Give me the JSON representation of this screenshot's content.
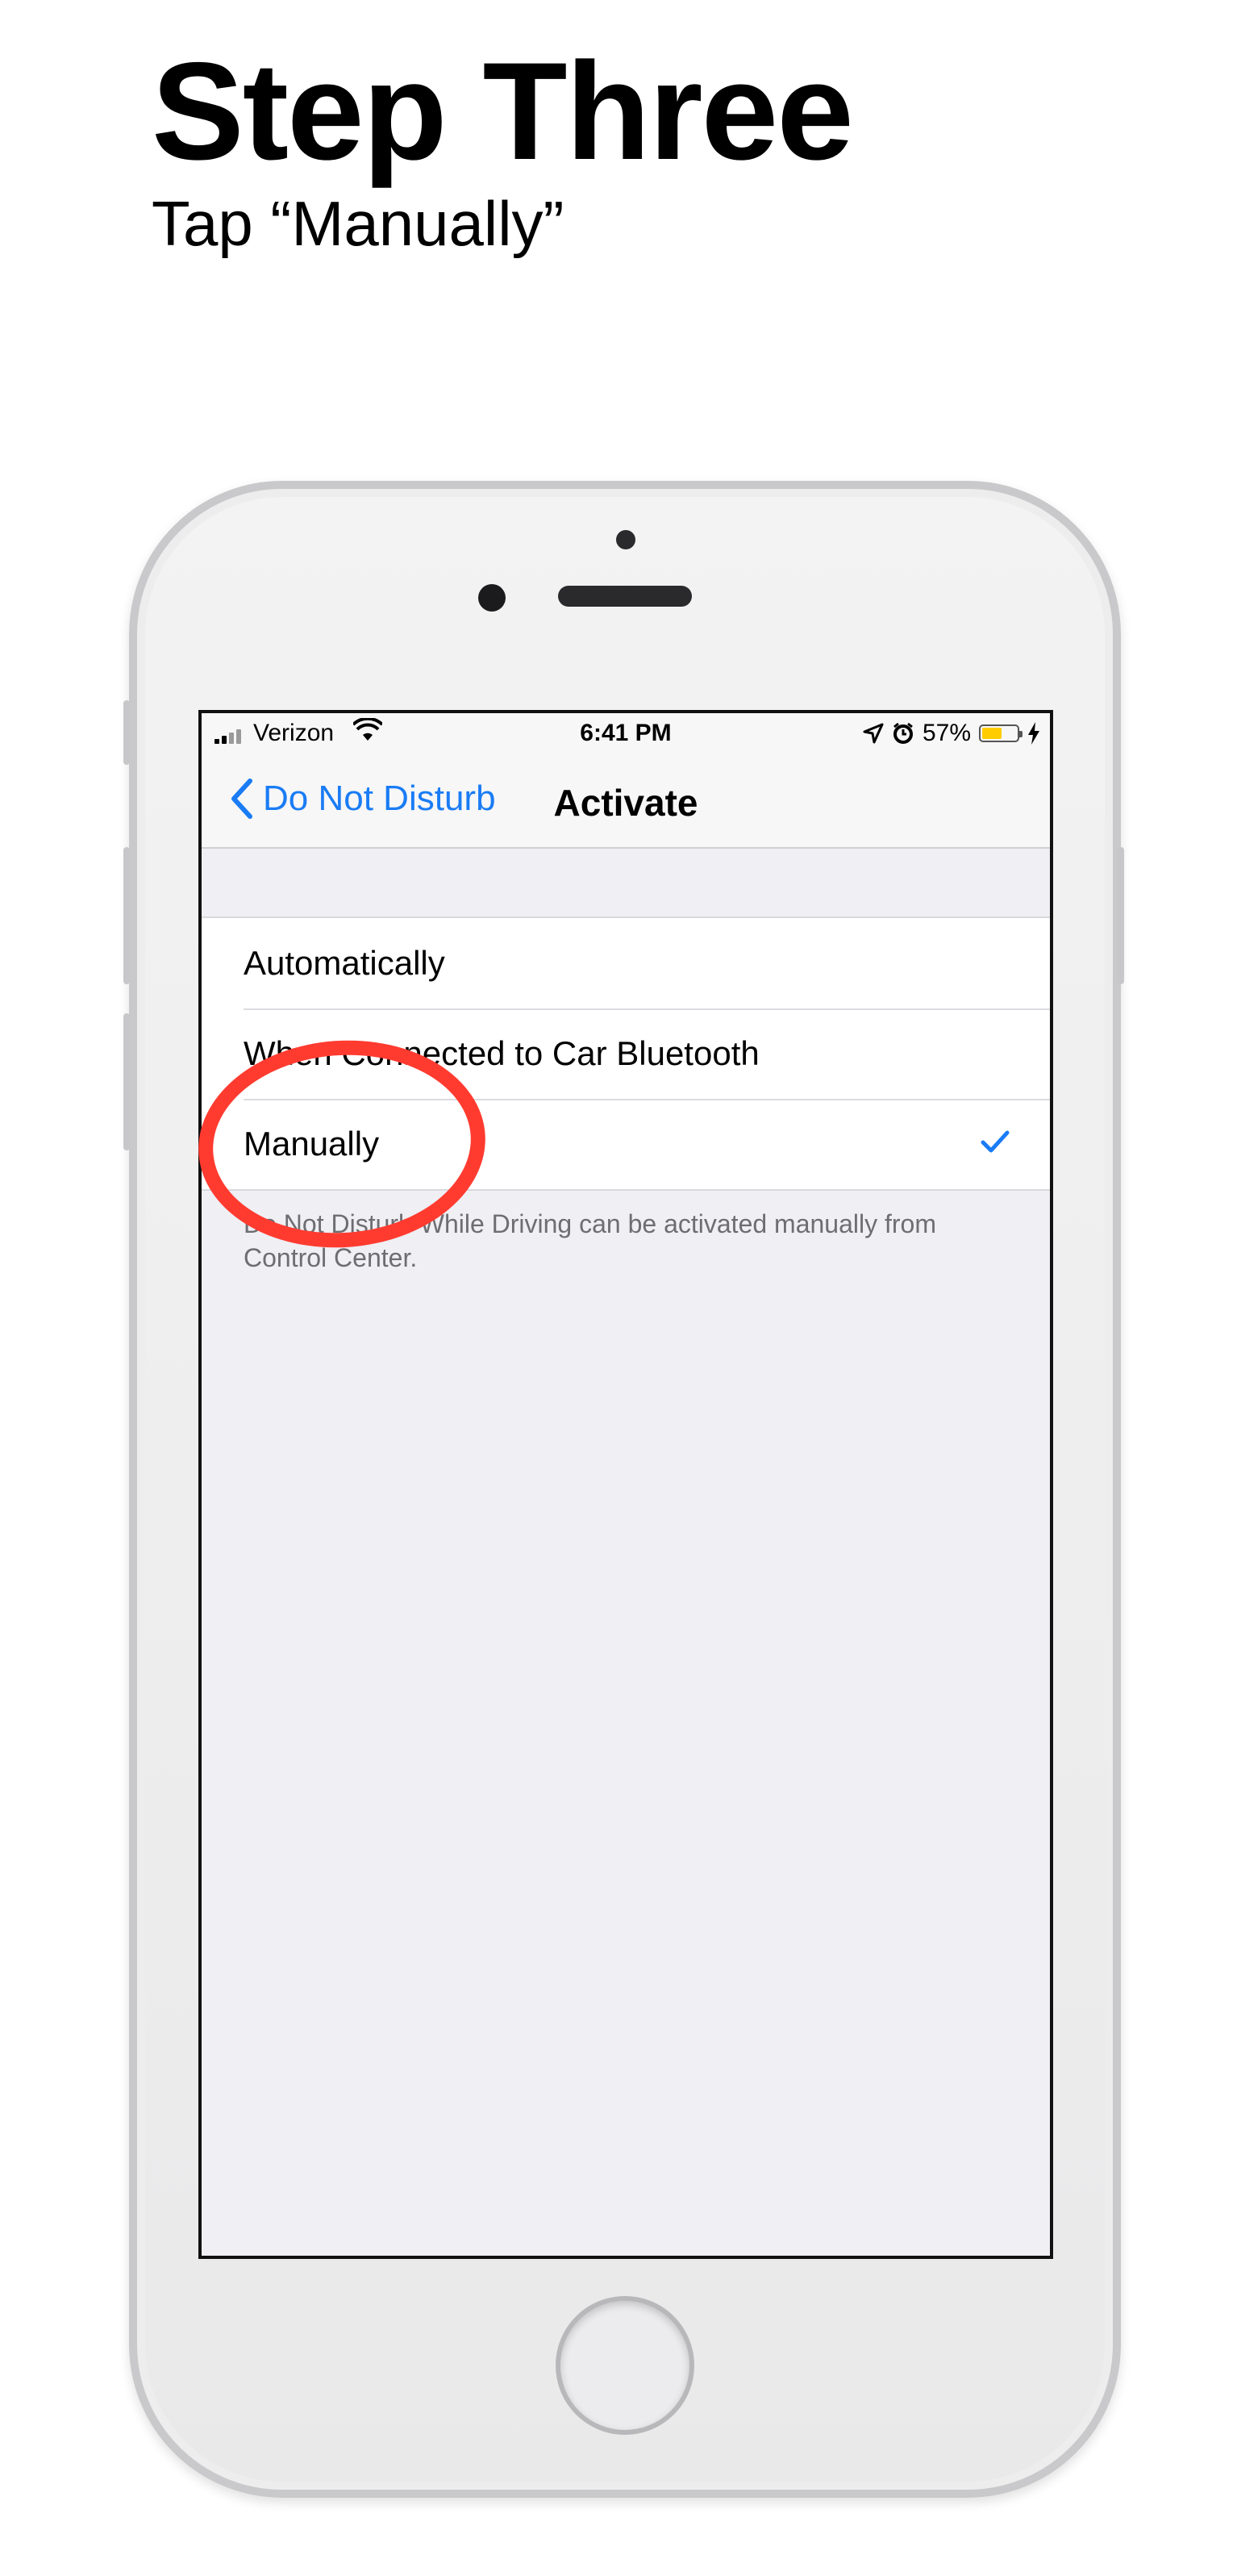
{
  "header": {
    "title": "Step Three",
    "subtitle": "Tap “Manually”"
  },
  "statusbar": {
    "carrier": "Verizon",
    "time": "6:41 PM",
    "battery_text": "57%",
    "battery_level": 0.57,
    "icons": [
      "signal-icon",
      "wifi-icon",
      "location-icon",
      "alarm-icon",
      "battery-icon",
      "charging-icon"
    ]
  },
  "navbar": {
    "back_label": "Do Not Disturb",
    "title": "Activate"
  },
  "options": [
    {
      "label": "Automatically",
      "selected": false
    },
    {
      "label": "When Connected to Car Bluetooth",
      "selected": false
    },
    {
      "label": "Manually",
      "selected": true
    }
  ],
  "footer_note": "Do Not Disturb While Driving can be activated manually from Control Center.",
  "colors": {
    "accent": "#1a7cf5",
    "highlight": "#ff3b30",
    "battery": "#ffcc00"
  }
}
